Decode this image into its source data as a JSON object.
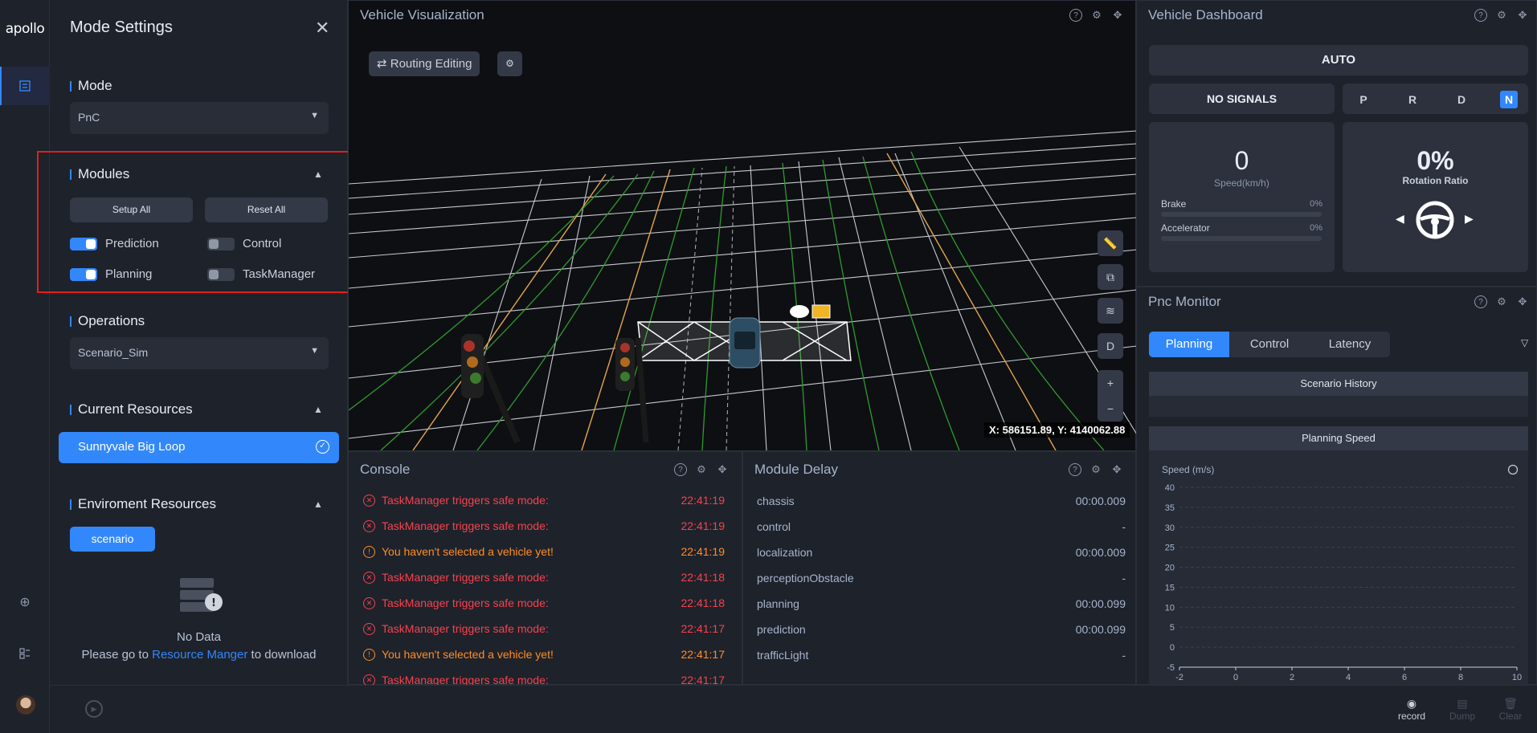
{
  "rail": {
    "logo": "apollo"
  },
  "settings": {
    "title": "Mode Settings",
    "mode": {
      "label": "Mode",
      "value": "PnC"
    },
    "modules": {
      "label": "Modules",
      "setup_all": "Setup All",
      "reset_all": "Reset All",
      "items": [
        {
          "name": "Prediction",
          "on": true
        },
        {
          "name": "Control",
          "on": false
        },
        {
          "name": "Planning",
          "on": true
        },
        {
          "name": "TaskManager",
          "on": false
        }
      ]
    },
    "operations": {
      "label": "Operations",
      "value": "Scenario_Sim"
    },
    "current_resources": {
      "label": "Current Resources",
      "selected": "Sunnyvale Big Loop"
    },
    "env_resources": {
      "label": "Enviroment Resources",
      "tag": "scenario",
      "no_data": "No Data",
      "hint_prefix": "Please go to",
      "hint_link": "Resource Manger",
      "hint_suffix": "to download"
    }
  },
  "viz": {
    "title": "Vehicle Visualization",
    "routing_button": "Routing Editing",
    "tools": [
      "ruler-icon",
      "copy-icon",
      "layers-icon",
      "D",
      "+",
      "−"
    ],
    "coords": "X: 586151.89, Y: 4140062.88"
  },
  "console": {
    "title": "Console",
    "rows": [
      {
        "type": "err",
        "msg": "TaskManager triggers safe mode:",
        "time": "22:41:19"
      },
      {
        "type": "err",
        "msg": "TaskManager triggers safe mode:",
        "time": "22:41:19"
      },
      {
        "type": "warn",
        "msg": "You haven't selected a vehicle yet!",
        "time": "22:41:19"
      },
      {
        "type": "err",
        "msg": "TaskManager triggers safe mode:",
        "time": "22:41:18"
      },
      {
        "type": "err",
        "msg": "TaskManager triggers safe mode:",
        "time": "22:41:18"
      },
      {
        "type": "err",
        "msg": "TaskManager triggers safe mode:",
        "time": "22:41:17"
      },
      {
        "type": "warn",
        "msg": "You haven't selected a vehicle yet!",
        "time": "22:41:17"
      },
      {
        "type": "err",
        "msg": "TaskManager triggers safe mode:",
        "time": "22:41:17"
      }
    ]
  },
  "delay": {
    "title": "Module Delay",
    "rows": [
      {
        "name": "chassis",
        "value": "00:00.009"
      },
      {
        "name": "control",
        "value": "-"
      },
      {
        "name": "localization",
        "value": "00:00.009"
      },
      {
        "name": "perceptionObstacle",
        "value": "-"
      },
      {
        "name": "planning",
        "value": "00:00.099"
      },
      {
        "name": "prediction",
        "value": "00:00.099"
      },
      {
        "name": "trafficLight",
        "value": "-"
      }
    ]
  },
  "dashboard": {
    "title": "Vehicle Dashboard",
    "mode": "AUTO",
    "signals": "NO SIGNALS",
    "gears": [
      "P",
      "R",
      "D",
      "N"
    ],
    "selected_gear": "N",
    "speed": "0",
    "speed_unit": "Speed(km/h)",
    "brake_label": "Brake",
    "brake_value": "0%",
    "accel_label": "Accelerator",
    "accel_value": "0%",
    "rotation": "0%",
    "rotation_label": "Rotation Ratio"
  },
  "pnc": {
    "title": "Pnc Monitor",
    "tabs": [
      "Planning",
      "Control",
      "Latency"
    ],
    "selected_tab": "Planning",
    "scenario_history": "Scenario History",
    "planning_speed": "Planning Speed"
  },
  "chart_data": {
    "type": "line",
    "title": "Planning Speed",
    "ylabel": "Speed (m/s)",
    "xlabel": "",
    "xlim": [
      -2,
      10
    ],
    "ylim": [
      -5,
      40
    ],
    "x_ticks": [
      -2,
      0,
      2,
      4,
      6,
      8,
      10
    ],
    "y_ticks": [
      40,
      35,
      30,
      25,
      20,
      15,
      10,
      5,
      0,
      -5
    ],
    "series": []
  },
  "bottom_bar": {
    "record": "record",
    "dump": "Dump",
    "clear": "Clear"
  }
}
